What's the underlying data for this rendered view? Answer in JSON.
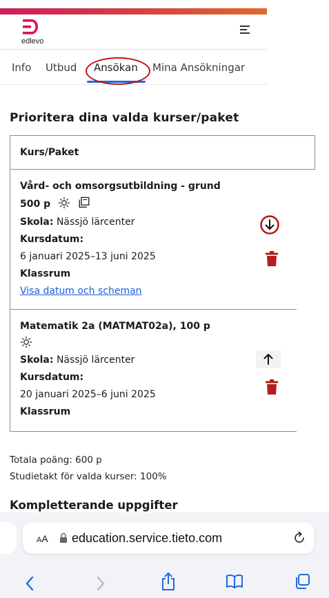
{
  "header": {
    "logo_text": "edlevo",
    "logo_color": "#d8154c",
    "menu_icon": "hamburger-icon"
  },
  "tabs": [
    {
      "label": "Info"
    },
    {
      "label": "Utbud"
    },
    {
      "label": "Ansökan",
      "active": true
    },
    {
      "label": "Mina Ansökningar"
    }
  ],
  "page_title": "Prioritera dina valda kurser/paket",
  "table": {
    "header": "Kurs/Paket",
    "rows": [
      {
        "title_line1": "Vård- och omsorgsutbildning - grund",
        "points": "500 p",
        "icons": [
          "sun-icon",
          "copy-icon"
        ],
        "school_label": "Skola:",
        "school_value": "Nässjö lärcenter",
        "date_label": "Kursdatum:",
        "date_value": "6 januari 2025–13 juni 2025",
        "room_label": "Klassrum",
        "link": "Visa datum och scheman",
        "move_icon": "arrow-down-circle-icon",
        "delete_icon": "trash-icon"
      },
      {
        "title_line1": "Matematik 2a (MATMAT02a), 100 p",
        "icons": [
          "sun-icon"
        ],
        "school_label": "Skola:",
        "school_value": "Nässjö lärcenter",
        "date_label": "Kursdatum:",
        "date_value": "20 januari 2025–6 juni 2025",
        "room_label": "Klassrum",
        "move_icon": "arrow-up-icon",
        "delete_icon": "trash-icon"
      }
    ]
  },
  "summary": {
    "total": "Totala poäng: 600 p",
    "pace": "Studietakt för valda kurser: 100%"
  },
  "next_section": "Kompletterande uppgifter",
  "browser": {
    "aa_label": "AA",
    "url": "education.service.tieto.com",
    "toolbar": [
      "back-icon",
      "forward-icon",
      "share-icon",
      "bookmarks-icon",
      "tabs-icon"
    ]
  },
  "colors": {
    "accent": "#1f6ad8",
    "delete": "#b41e1e",
    "annotation": "#c01010"
  }
}
